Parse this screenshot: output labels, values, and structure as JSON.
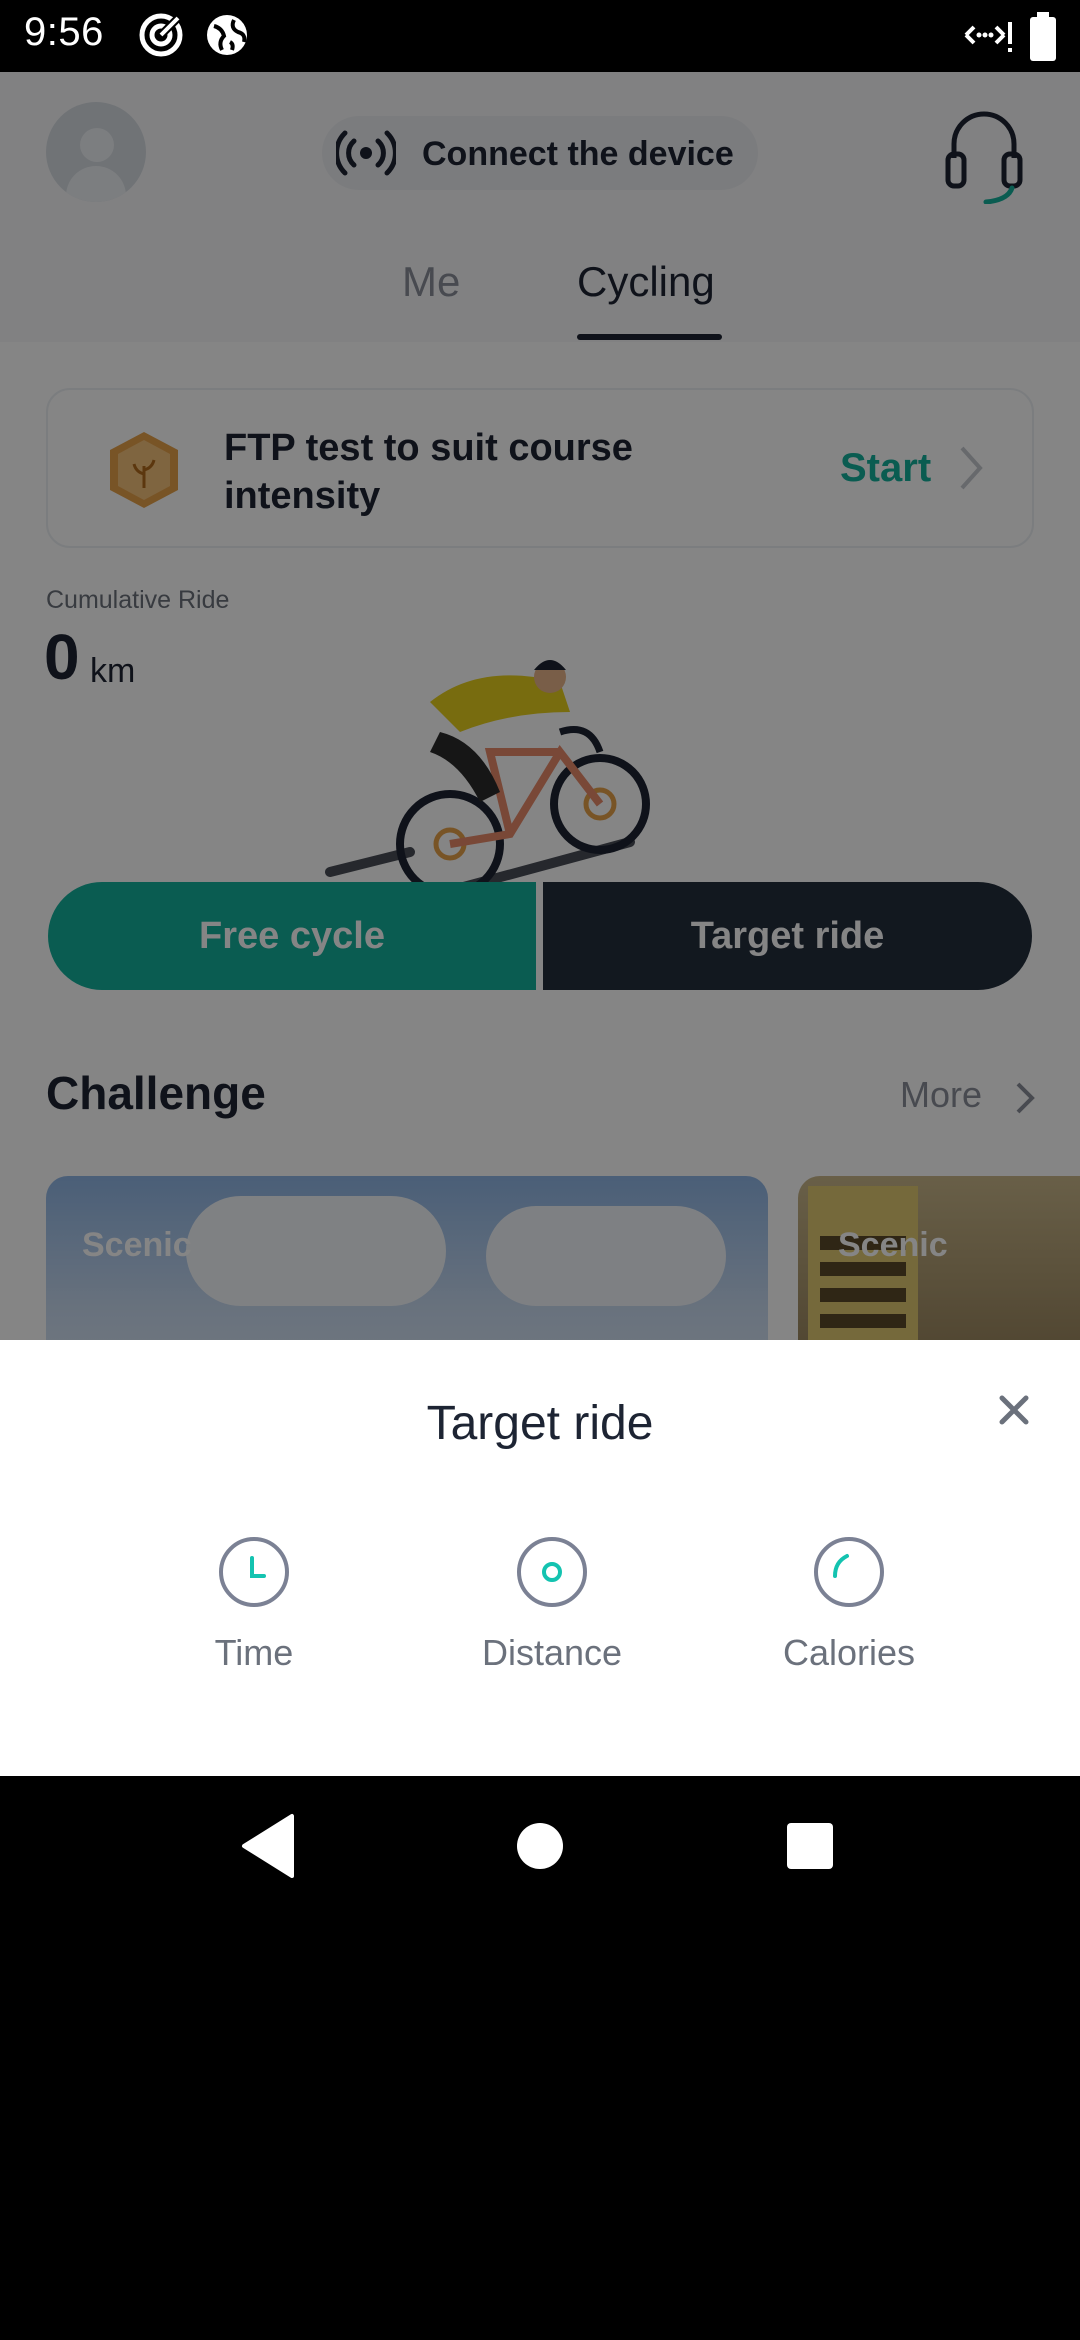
{
  "status_bar": {
    "time": "9:56",
    "left_icons": [
      "target-app-icon",
      "globe-icon"
    ],
    "right_icons": [
      "data-transfer-icon",
      "battery-icon"
    ]
  },
  "header": {
    "connect_label": "Connect the device",
    "tabs": [
      {
        "label": "Me",
        "active": false
      },
      {
        "label": "Cycling",
        "active": true
      }
    ]
  },
  "ftp_card": {
    "title": "FTP test to suit course intensity",
    "action": "Start"
  },
  "cumulative": {
    "label": "Cumulative Ride",
    "value": "0",
    "unit": "km"
  },
  "mode_buttons": {
    "free": "Free cycle",
    "target": "Target ride"
  },
  "challenge": {
    "title": "Challenge",
    "more": "More",
    "cards": [
      {
        "tag": "Scenic"
      },
      {
        "tag": "Scenic"
      }
    ]
  },
  "sheet": {
    "title": "Target ride",
    "options": [
      {
        "label": "Time",
        "icon": "clock-icon"
      },
      {
        "label": "Distance",
        "icon": "distance-icon"
      },
      {
        "label": "Calories",
        "icon": "calories-icon"
      }
    ]
  },
  "colors": {
    "accent": "#14b09c",
    "dark_button": "#232e3d",
    "text_primary": "#1d2433",
    "text_secondary": "#6b717c"
  }
}
